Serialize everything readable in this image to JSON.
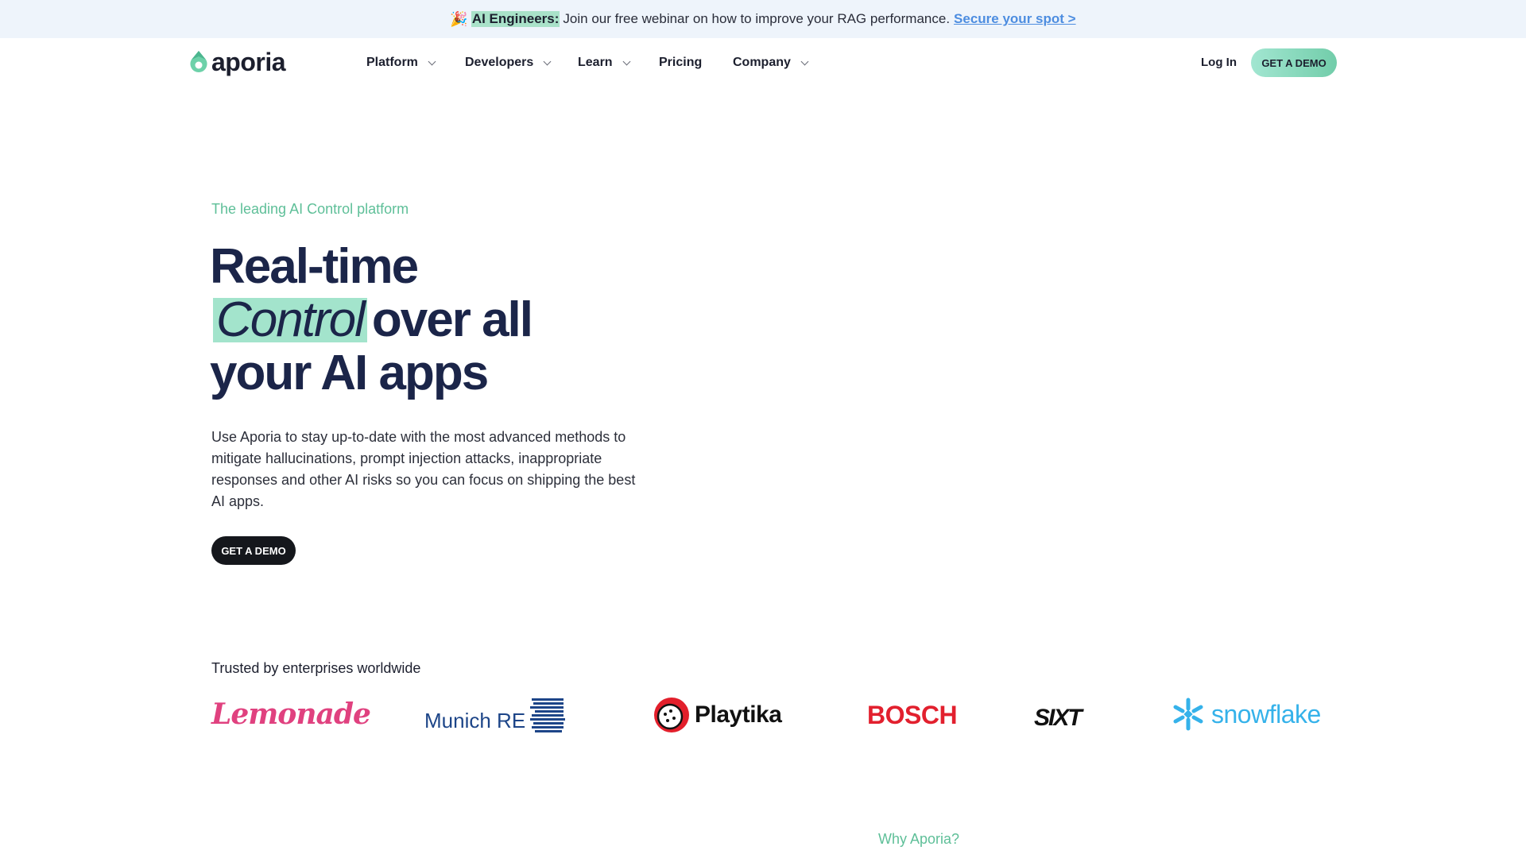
{
  "banner": {
    "emoji": "🎉",
    "highlight": "AI Engineers:",
    "message": "Join our free webinar on how to improve your RAG performance.",
    "link": "Secure your spot >"
  },
  "header": {
    "logo_text": "aporia",
    "nav": [
      "Platform",
      "Developers",
      "Learn",
      "Pricing",
      "Company"
    ],
    "login": "Log In",
    "cta": "GET A DEMO"
  },
  "hero": {
    "eyebrow": "The leading AI Control platform",
    "title_line1": "Real-time",
    "title_accent": "Control",
    "title_line2_rest": "over all",
    "title_line3": "your AI apps",
    "description": "Use Aporia to stay up-to-date with the most advanced methods to mitigate hallucinations, prompt injection attacks, inappropriate responses and other AI risks so you can focus on shipping the best AI apps.",
    "cta": "GET A DEMO"
  },
  "trusted": {
    "heading": "Trusted by enterprises worldwide",
    "logos": [
      "Lemonade",
      "Munich RE",
      "Playtika",
      "BOSCH",
      "SIXT",
      "snowflake"
    ]
  },
  "why": {
    "label": "Why Aporia?"
  },
  "colors": {
    "accent_green": "#5ebf98",
    "highlight_green": "#a3e4cc",
    "navy": "#1b2549",
    "banner_bg": "#eef4fb",
    "link_blue": "#4d8de0"
  }
}
